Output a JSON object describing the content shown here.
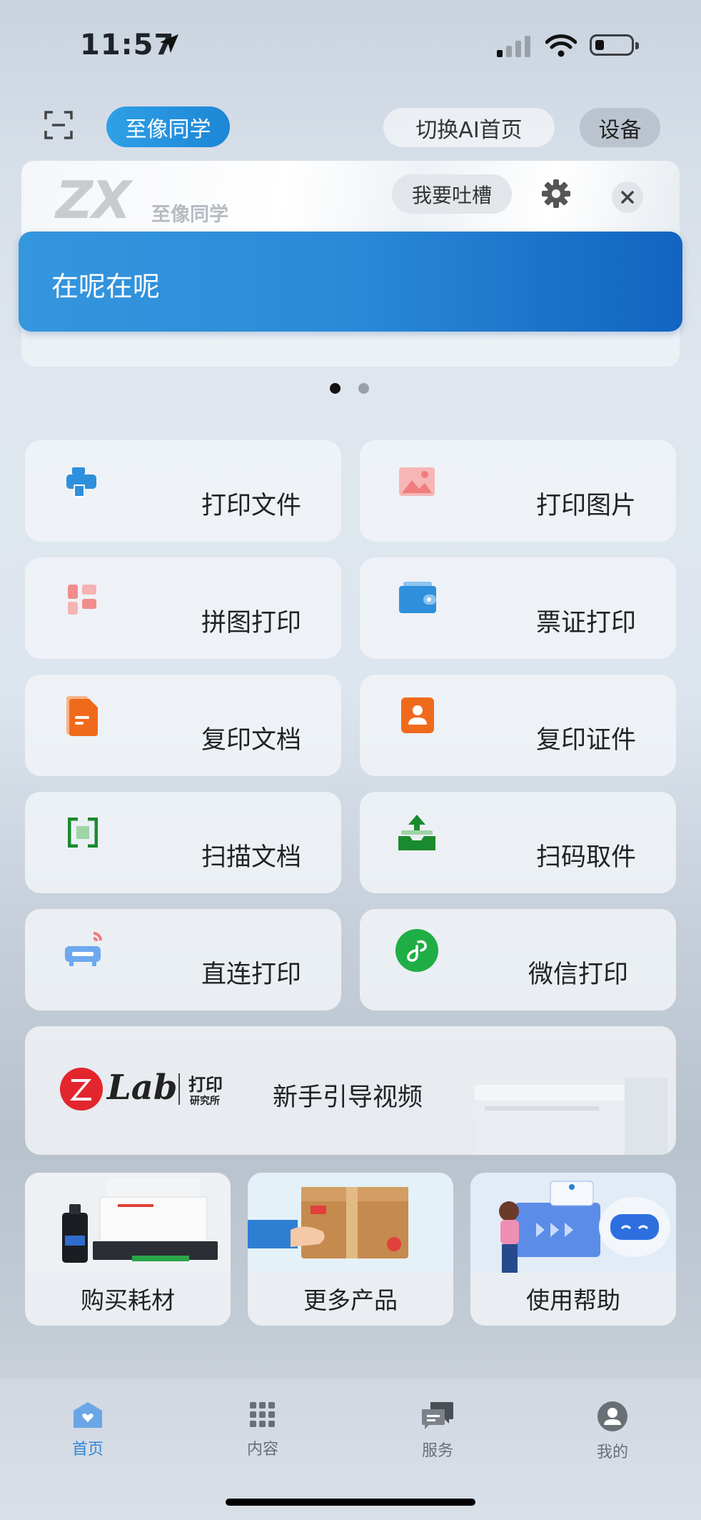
{
  "status_bar": {
    "time": "11:57"
  },
  "top_bar": {
    "brand": "至像同学",
    "switch_label": "切换AI首页",
    "device_label": "设备"
  },
  "banner": {
    "logo_text": "ZX",
    "logo_subtitle": "至像同学",
    "complain_label": "我要吐槽",
    "message": "在呢在呢",
    "page_count": 2,
    "active_page": 1
  },
  "features": [
    {
      "label": "打印文件",
      "icon": "printer-icon"
    },
    {
      "label": "打印图片",
      "icon": "image-icon"
    },
    {
      "label": "拼图打印",
      "icon": "collage-icon"
    },
    {
      "label": "票证打印",
      "icon": "wallet-icon"
    },
    {
      "label": "复印文档",
      "icon": "document-icon"
    },
    {
      "label": "复印证件",
      "icon": "id-card-icon"
    },
    {
      "label": "扫描文档",
      "icon": "scan-icon"
    },
    {
      "label": "扫码取件",
      "icon": "tray-upload-icon"
    },
    {
      "label": "直连打印",
      "icon": "wireless-printer-icon"
    },
    {
      "label": "微信打印",
      "icon": "wechat-miniprogram-icon"
    }
  ],
  "zlab": {
    "logo": "Lab",
    "logo_tag_top": "打印",
    "logo_tag_bottom": "研究所",
    "label": "新手引导视频"
  },
  "cards": [
    {
      "label": "购买耗材"
    },
    {
      "label": "更多产品"
    },
    {
      "label": "使用帮助"
    }
  ],
  "tabs": [
    {
      "label": "首页",
      "active": true
    },
    {
      "label": "内容",
      "active": false
    },
    {
      "label": "服务",
      "active": false
    },
    {
      "label": "我的",
      "active": false
    }
  ],
  "colors": {
    "accent": "#2e8fdc",
    "tab_active": "#2f86db",
    "tab_inactive": "#6a6f76"
  }
}
